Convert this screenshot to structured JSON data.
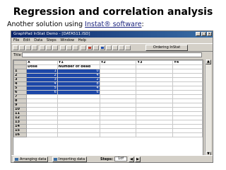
{
  "slide": {
    "title": "Regression and correlation analysis",
    "subtitle_prefix": "Another solution using ",
    "subtitle_link": "Instat® software",
    "subtitle_suffix": ":"
  },
  "window": {
    "title": "GraphPad InStat Demo - [DATA511.ISD]",
    "menu": [
      "File",
      "Edit",
      "Data",
      "Steps",
      "Window",
      "Help"
    ],
    "ordering_button": "Ordering InStat",
    "title_field_label": "Title",
    "title_field_value": ""
  },
  "sheet": {
    "columns": [
      "X",
      "Y1",
      "Y2",
      "Y3",
      "Y4"
    ],
    "subheaders": [
      "Dose",
      "Number of dead",
      "",
      "",
      ""
    ],
    "row_numbers": [
      "1",
      "2",
      "3",
      "4",
      "5",
      "6",
      "7",
      "8",
      "9",
      "10",
      "11",
      "12",
      "13",
      "14",
      "15",
      "16"
    ],
    "data": [
      {
        "x": "1",
        "y1": "0"
      },
      {
        "x": "2",
        "y1": "4"
      },
      {
        "x": "3",
        "y1": "2"
      },
      {
        "x": "4",
        "y1": "8"
      },
      {
        "x": "5",
        "y1": "4"
      },
      {
        "x": "6",
        "y1": "6"
      }
    ]
  },
  "statusbar": {
    "arranging_label": "Arranging data",
    "importing_label": "Importing data",
    "steps_label": "Steps:",
    "steps_value": "1of"
  },
  "colors": {
    "selection": "#1c47a8",
    "titlebar": "#0a246a",
    "chrome": "#d4d0c8"
  }
}
